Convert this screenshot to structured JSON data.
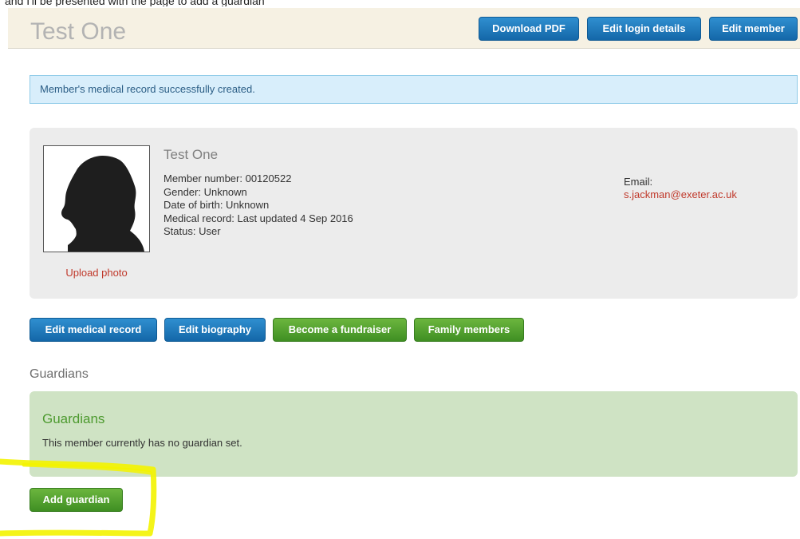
{
  "caption_fragment": "and I'll be presented with the page to add a guardian",
  "header": {
    "title": "Test One",
    "download_pdf": "Download PDF",
    "edit_login": "Edit login details",
    "edit_member": "Edit member"
  },
  "alert": {
    "message": "Member's medical record successfully created."
  },
  "profile": {
    "name": "Test One",
    "member_number": "Member number: 00120522",
    "gender": "Gender: Unknown",
    "dob": "Date of birth: Unknown",
    "medical_record": "Medical record: Last updated 4 Sep 2016",
    "status": "Status: User",
    "email_label": "Email:",
    "email": "s.jackman@exeter.ac.uk",
    "upload_photo": "Upload photo"
  },
  "actions": {
    "edit_medical": "Edit medical record",
    "edit_biography": "Edit biography",
    "become_fundraiser": "Become a fundraiser",
    "family_members": "Family members"
  },
  "guardians": {
    "section_heading": "Guardians",
    "panel_title": "Guardians",
    "empty_text": "This member currently has no guardian set.",
    "add_button": "Add guardian"
  },
  "colors": {
    "primary_button": "#1f7bbf",
    "success_button": "#54a030",
    "link": "#c0392b",
    "highlight": "#f5f500"
  },
  "icons": {
    "avatar": "female-silhouette-icon"
  }
}
